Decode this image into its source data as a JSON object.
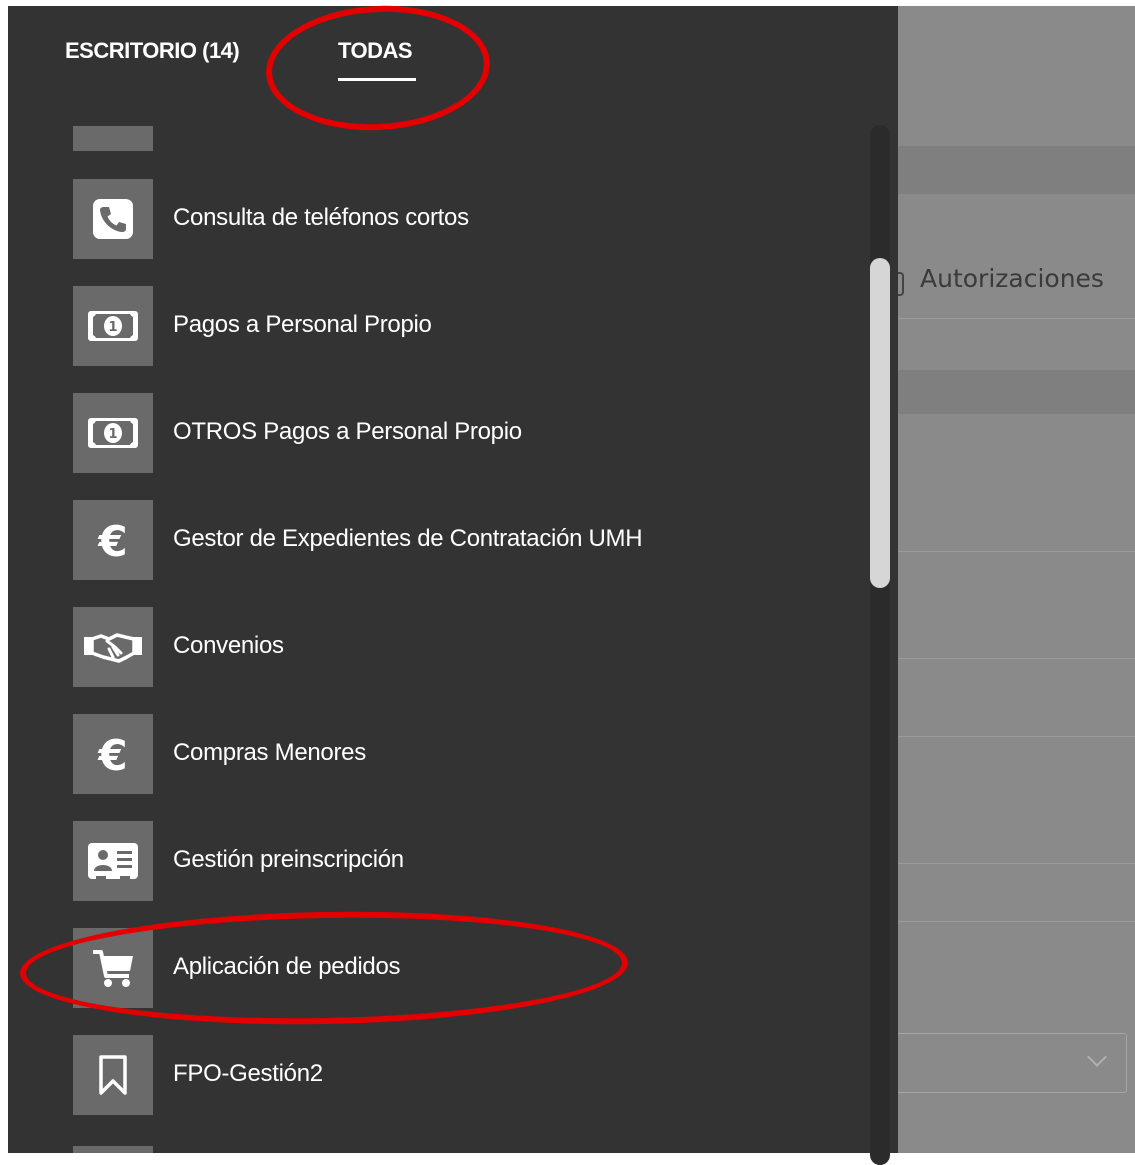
{
  "tabs": [
    {
      "label": "ESCRITORIO (14)",
      "active": false
    },
    {
      "label": "TODAS",
      "active": true
    }
  ],
  "apps": [
    {
      "label": "Consulta de teléfonos cortos",
      "icon": "phone-icon"
    },
    {
      "label": "Pagos a Personal Propio",
      "icon": "banknote-icon"
    },
    {
      "label": "OTROS Pagos a Personal Propio",
      "icon": "banknote-icon"
    },
    {
      "label": "Gestor de Expedientes de Contratación UMH",
      "icon": "euro-icon"
    },
    {
      "label": "Convenios",
      "icon": "handshake-icon"
    },
    {
      "label": "Compras Menores",
      "icon": "euro-icon"
    },
    {
      "label": "Gestión preinscripción",
      "icon": "contact-card-icon"
    },
    {
      "label": "Aplicación de pedidos",
      "icon": "shopping-cart-icon"
    },
    {
      "label": "FPO-Gestión2",
      "icon": "bookmark-icon"
    }
  ],
  "background": {
    "autorizaciones_label": "Autorizaciones"
  },
  "colors": {
    "sidebar_bg": "#333333",
    "icon_tile_bg": "#6a6a6a",
    "overlay_bg": "#8a8a8a",
    "annotation_red": "#e30000",
    "text": "#ffffff"
  }
}
